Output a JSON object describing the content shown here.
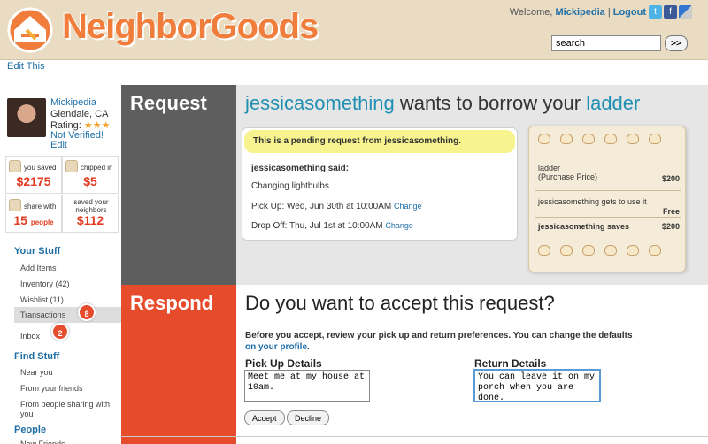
{
  "header": {
    "brand": "NeighborGoods",
    "welcome_prefix": "Welcome,",
    "username": "Mickipedia",
    "separator": "|",
    "logout": "Logout",
    "search_value": "search",
    "search_button": ">>",
    "social": [
      "twitter-icon",
      "facebook-icon",
      "delicious-icon"
    ]
  },
  "edit_this": "Edit This",
  "profile": {
    "name": "Mickipedia",
    "location": "Glendale, CA",
    "rating_label": "Rating:",
    "rating_stars": "★★★",
    "rating_value": 3,
    "verified": "Not Verified!",
    "edit": "Edit"
  },
  "stats": {
    "saved_label": "you saved",
    "saved_value": "$2175",
    "chipped_label": "chipped in",
    "chipped_value": "$5",
    "share_label": "share with",
    "share_value": "15",
    "share_unit": "people",
    "neighbors_label": "saved your neighbors",
    "neighbors_value": "$112"
  },
  "nav": {
    "your_stuff": "Your Stuff",
    "items": [
      "Add Items",
      "Inventory (42)",
      "Wishlist (11)",
      "Transactions",
      "Inbox"
    ],
    "transactions_badge": "8",
    "inbox_badge": "2",
    "find_stuff": "Find Stuff",
    "find_items": [
      "Near you",
      "From your friends",
      "From people sharing with you"
    ],
    "people": "People",
    "people_items": [
      "New Friends"
    ]
  },
  "request": {
    "section_label": "Request",
    "borrower": "jessicasomething",
    "title_middle": "wants to borrow your",
    "item": "ladder",
    "pending": "This is a pending request from jessicasomething.",
    "said": "jessicasomething said:",
    "message": "Changing lightbulbs",
    "pickup": "Pick Up: Wed, Jun 30th at 10:00AM",
    "dropoff": "Drop Off: Thu, Jul 1st at 10:00AM",
    "change": "Change"
  },
  "price": {
    "item_line1": "ladder",
    "item_line2": "(Purchase Price)",
    "item_amount": "$200",
    "gets_line": "jessicasomething gets to use it",
    "gets_amount": "Free",
    "saves_line": "jessicasomething saves",
    "saves_amount": "$200"
  },
  "respond": {
    "section_label": "Respond",
    "question": "Do you want to accept this request?",
    "before_text": "Before you accept, review your pick up and return preferences. You can change the defaults",
    "profile_link": "on your profile",
    "profile_period": ".",
    "pickup_label": "Pick Up Details",
    "pickup_value": "Meet me at my house at 10am.",
    "return_label": "Return Details",
    "return_value": "You can leave it on my porch when you are done.",
    "accept": "Accept",
    "decline": "Decline"
  },
  "colors": {
    "brand": "#f07d3b",
    "link": "#1f6fa7",
    "request_bar": "#5e5e5e",
    "respond_bar": "#e64b2c",
    "pending_bg": "#f7f38f"
  }
}
